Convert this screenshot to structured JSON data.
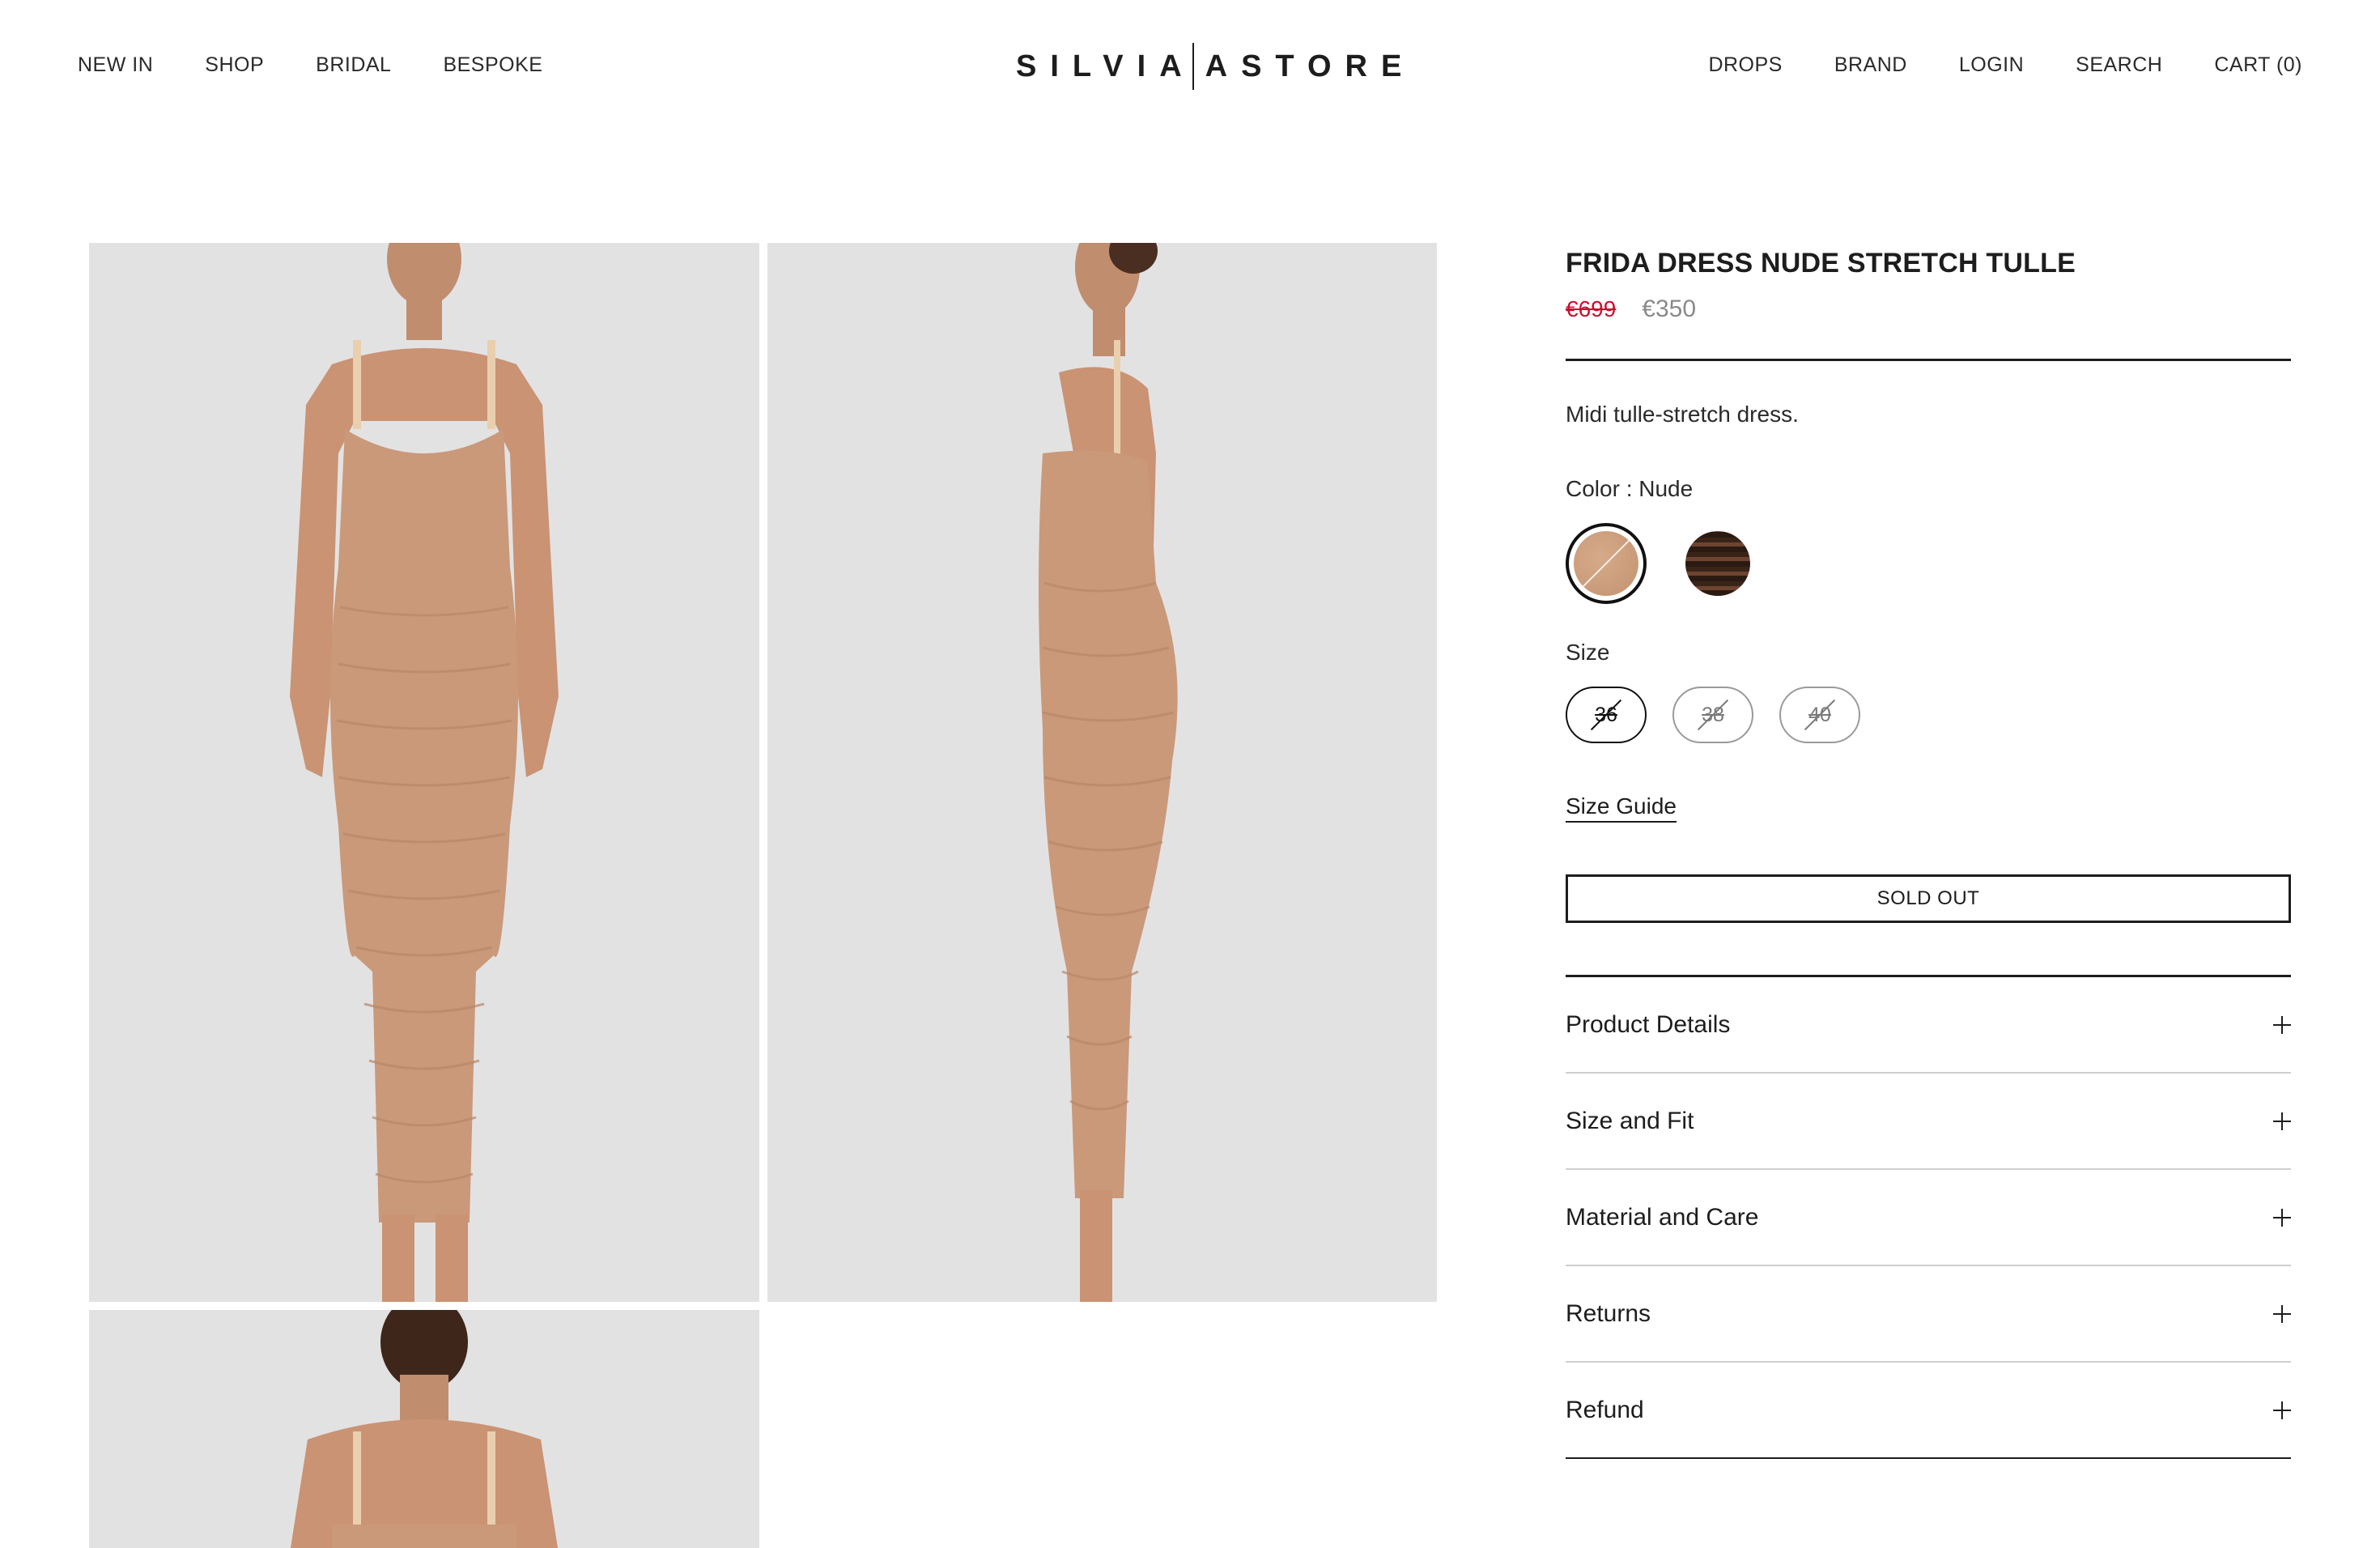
{
  "header": {
    "nav_left": [
      "NEW IN",
      "SHOP",
      "BRIDAL",
      "BESPOKE"
    ],
    "nav_right": [
      "DROPS",
      "BRAND",
      "LOGIN",
      "SEARCH",
      "CART (0)"
    ],
    "logo_left": "SILVIA",
    "logo_right": "ASTORE"
  },
  "gallery": {
    "images": [
      "front-view",
      "side-view",
      "back-view"
    ]
  },
  "product": {
    "title": "FRIDA DRESS NUDE STRETCH TULLE",
    "price_original": "€699",
    "price_sale": "€350",
    "description": "Midi tulle-stretch dress.",
    "color_label": "Color : Nude",
    "colors": [
      {
        "name": "Nude",
        "hex": "#c9997a",
        "selected": true,
        "available": false
      },
      {
        "name": "Brown",
        "hex": "#4a2c1f",
        "selected": false,
        "available": true
      }
    ],
    "size_label": "Size",
    "sizes": [
      {
        "label": "36",
        "selected": true,
        "available": false
      },
      {
        "label": "38",
        "selected": false,
        "available": false
      },
      {
        "label": "40",
        "selected": false,
        "available": false
      }
    ],
    "size_guide": "Size Guide",
    "cta": "SOLD OUT",
    "accordion": [
      "Product Details",
      "Size and Fit",
      "Material and Care",
      "Returns",
      "Refund"
    ]
  },
  "colors": {
    "text": "#1d1d1d",
    "sale_red": "#c8102e",
    "price_grey": "#8a8a8a",
    "image_bg": "#e3e2e3",
    "dress": "#c9997a"
  }
}
